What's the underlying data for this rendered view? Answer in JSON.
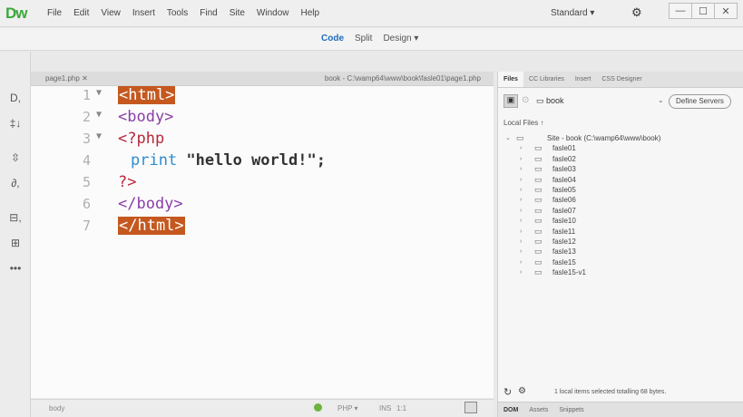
{
  "app": {
    "logo": "Dw"
  },
  "menubar": {
    "items": [
      "File",
      "Edit",
      "View",
      "Insert",
      "Tools",
      "Find",
      "Site",
      "Window",
      "Help"
    ],
    "workspace": "Standard",
    "workspace_arrow": "▾",
    "gear_icon": "gear-icon",
    "window_buttons": [
      "—",
      "☐",
      "✕"
    ]
  },
  "viewbar": {
    "code": "Code",
    "split": "Split",
    "design": "Design",
    "design_arrow": "▾"
  },
  "lefttools": [
    "D,",
    "‡↓",
    "⇳",
    "∂,",
    "⊟,",
    "⊞",
    "•••"
  ],
  "document": {
    "tab_name": "page1.php",
    "tab_close": "✕",
    "path": "book - C:\\wamp64\\www\\book\\fasle01\\page1.php",
    "lines": [
      {
        "num": "1",
        "fold": "▼"
      },
      {
        "num": "2",
        "fold": "▼"
      },
      {
        "num": "3",
        "fold": "▼"
      },
      {
        "num": "4",
        "fold": ""
      },
      {
        "num": "5",
        "fold": ""
      },
      {
        "num": "6",
        "fold": ""
      },
      {
        "num": "7",
        "fold": ""
      }
    ],
    "code": {
      "l1": "<html>",
      "l2": "<body>",
      "l3": "<?php",
      "l4_kw": "print",
      "l4_str": " \"hello world!\";",
      "l5": "?>",
      "l6": "</body>",
      "l7": "</html>"
    }
  },
  "statusbar": {
    "crumb": "body",
    "lang": "PHP",
    "lang_arrow": "▾",
    "mode": "INS",
    "pos": "1:1"
  },
  "files_panel": {
    "tabs": [
      "Files",
      "CC Libraries",
      "Insert",
      "CSS Designer"
    ],
    "site": "book",
    "define_servers": "Define Servers",
    "local_files": "Local Files ↑",
    "root": "Site - book (C:\\wamp64\\www\\book)",
    "folders": [
      "fasle01",
      "fasle02",
      "fasle03",
      "fasle04",
      "fasle05",
      "fasle06",
      "fasle07",
      "fasle10",
      "fasle11",
      "fasle12",
      "fasle13",
      "fasle15",
      "fasle15-v1"
    ],
    "status_msg": "1 local items selected totalling 68 bytes.",
    "bottom_tabs": [
      "DOM",
      "Assets",
      "Snippets"
    ]
  }
}
